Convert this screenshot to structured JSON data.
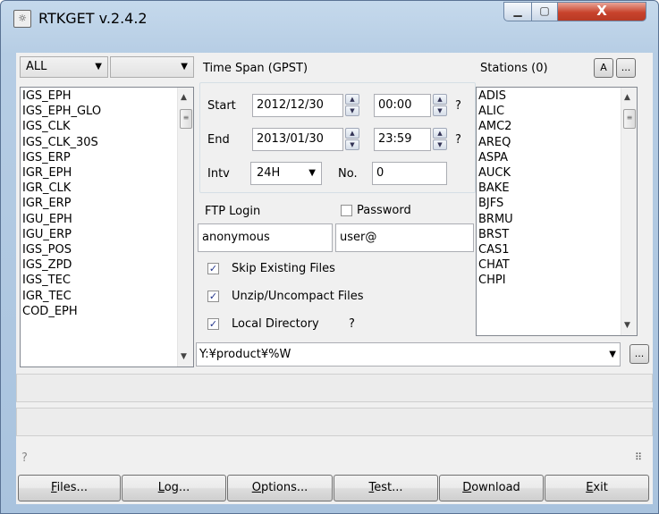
{
  "window": {
    "title": "RTKGET v.2.4.2",
    "minimize": "▁",
    "maximize": "▢",
    "close": "X"
  },
  "types": {
    "filter1": "ALL",
    "filter2": "",
    "items": [
      "IGS_EPH",
      "IGS_EPH_GLO",
      "IGS_CLK",
      "IGS_CLK_30S",
      "IGS_ERP",
      "IGR_EPH",
      "IGR_CLK",
      "IGR_ERP",
      "IGU_EPH",
      "IGU_ERP",
      "IGS_POS",
      "IGS_ZPD",
      "IGS_TEC",
      "IGR_TEC",
      "COD_EPH"
    ]
  },
  "timespan": {
    "label": "Time Span (GPST)",
    "start_label": "Start",
    "start_date": "2012/12/30",
    "start_time": "00:00",
    "end_label": "End",
    "end_date": "2013/01/30",
    "end_time": "23:59",
    "q": "?",
    "intv_label": "Intv",
    "intv_value": "24H",
    "no_label": "No.",
    "no_value": "0"
  },
  "ftp": {
    "login_label": "FTP Login",
    "password_label": "Password",
    "login_value": "anonymous",
    "password_value": "user@"
  },
  "options": {
    "skip": "Skip Existing Files",
    "unzip": "Unzip/Uncompact Files",
    "localdir": "Local Directory",
    "q": "?",
    "path": "Y:¥product¥%W"
  },
  "stations": {
    "label": "Stations (0)",
    "btn_a": "A",
    "btn_more": "...",
    "items": [
      "ADIS",
      "ALIC",
      "AMC2",
      "AREQ",
      "ASPA",
      "AUCK",
      "BAKE",
      "BJFS",
      "BRMU",
      "BRST",
      "CAS1",
      "CHAT",
      "CHPI"
    ]
  },
  "status": {
    "text": "?"
  },
  "buttons": {
    "files_u": "F",
    "files_rest": "iles...",
    "log_u": "L",
    "log_rest": "og...",
    "options_u": "O",
    "options_rest": "ptions...",
    "test_u": "T",
    "test_rest": "est...",
    "download_u": "D",
    "download_rest": "ownload",
    "exit_u": "E",
    "exit_rest": "xit",
    "dir_more": "..."
  }
}
